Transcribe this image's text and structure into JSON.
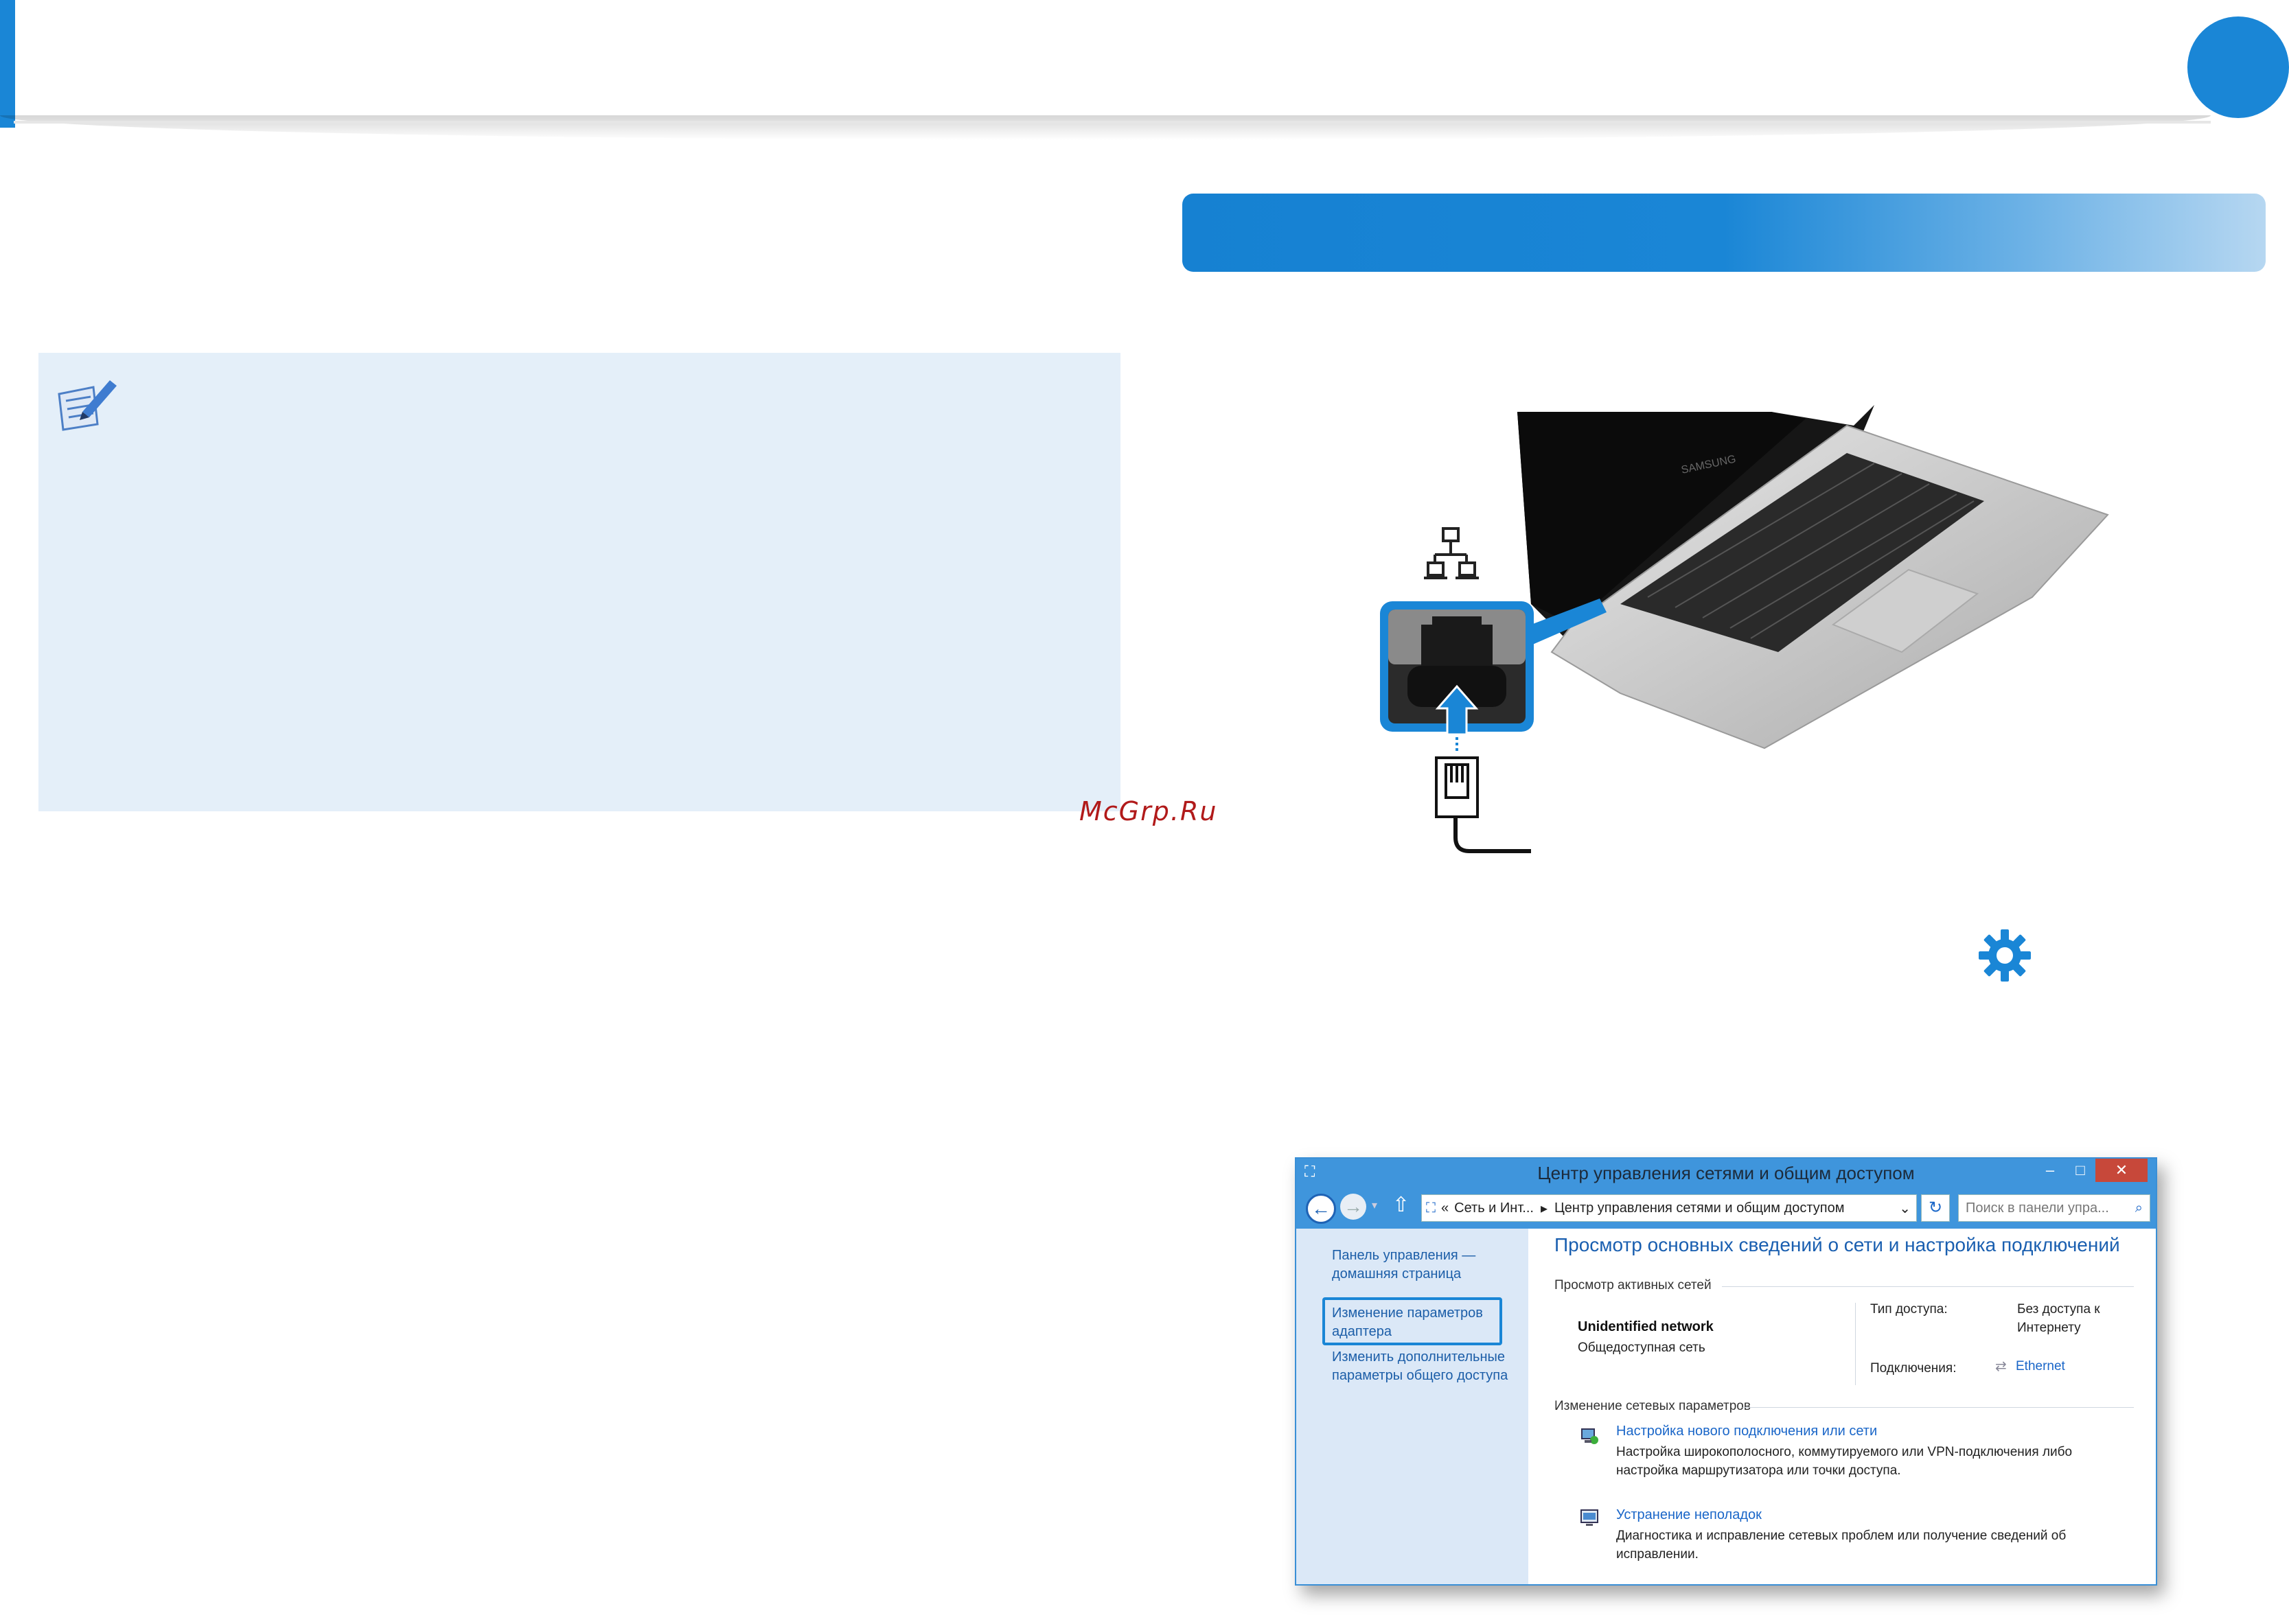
{
  "watermark": "McGrp.Ru",
  "window": {
    "title": "Центр управления сетями и общим доступом",
    "breadcrumb_sep": "«",
    "breadcrumb_1": "Сеть и Инт...",
    "breadcrumb_arrow": "▸",
    "breadcrumb_2": "Центр управления сетями и общим доступом",
    "search_placeholder": "Поиск в панели упра...",
    "sidebar": {
      "home_line1": "Панель управления —",
      "home_line2": "домашняя страница",
      "adapter_line1": "Изменение параметров",
      "adapter_line2": "адаптера",
      "sharing_line1": "Изменить дополнительные",
      "sharing_line2": "параметры общего доступа"
    },
    "main": {
      "heading": "Просмотр основных сведений о сети и настройка подключений",
      "active_networks_label": "Просмотр активных сетей",
      "network_name": "Unidentified network",
      "network_type": "Общедоступная сеть",
      "access_type_label": "Тип доступа:",
      "access_value_line1": "Без доступа к",
      "access_value_line2": "Интернету",
      "connections_label": "Подключения:",
      "connection_value": "Ethernet",
      "change_settings_label": "Изменение сетевых параметров",
      "setup_link": "Настройка нового подключения или сети",
      "setup_desc_line1": "Настройка широкополосного, коммутируемого или VPN-подключения либо",
      "setup_desc_line2": "настройка маршрутизатора или точки доступа.",
      "troubleshoot_link": "Устранение неполадок",
      "troubleshoot_desc_line1": "Диагностика и исправление сетевых проблем или получение сведений об",
      "troubleshoot_desc_line2": "исправлении."
    }
  },
  "laptop_brand": "SAMSUNG",
  "colors": {
    "accent": "#1a86d6",
    "note_bg": "#e4eff9",
    "watermark": "#b11a1a"
  },
  "icons": [
    "note-pencil-icon",
    "network-icon",
    "gear-icon",
    "rj45-connector-icon"
  ]
}
